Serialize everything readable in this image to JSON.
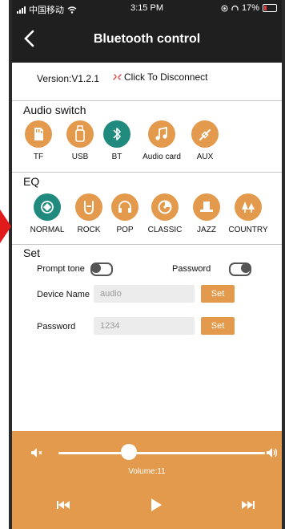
{
  "status_bar": {
    "carrier": "中国移动",
    "time": "3:15 PM",
    "battery": "17%"
  },
  "nav": {
    "title": "Bluetooth control"
  },
  "device": {
    "version": "Version:V1.2.1",
    "disconnect": "Click To Disconnect"
  },
  "audio_switch": {
    "title": "Audio switch",
    "selected": "BT",
    "items": [
      {
        "label": "TF",
        "icon": "sd-card-icon"
      },
      {
        "label": "USB",
        "icon": "usb-drive-icon"
      },
      {
        "label": "BT",
        "icon": "bluetooth-icon"
      },
      {
        "label": "Audio card",
        "icon": "music-note-icon"
      },
      {
        "label": "AUX",
        "icon": "aux-cable-icon"
      }
    ]
  },
  "eq": {
    "title": "EQ",
    "selected": "NORMAL",
    "items": [
      {
        "label": "NORMAL",
        "icon": "target-icon"
      },
      {
        "label": "ROCK",
        "icon": "rock-hand-icon"
      },
      {
        "label": "POP",
        "icon": "headphones-icon"
      },
      {
        "label": "CLASSIC",
        "icon": "disc-icon"
      },
      {
        "label": "JAZZ",
        "icon": "hat-icon"
      },
      {
        "label": "COUNTRY",
        "icon": "trees-icon"
      }
    ]
  },
  "settings": {
    "title": "Set",
    "prompt_tone_label": "Prompt tone",
    "prompt_tone_on": false,
    "password_label": "Password",
    "password_on": false,
    "device_name_label": "Device Name",
    "device_name_value": "audio",
    "password_field_label": "Password",
    "password_value": "1234",
    "set_button": "Set"
  },
  "player": {
    "volume_text": "Volume:11",
    "volume_fraction": 0.34
  },
  "colors": {
    "accent": "#e39a4c",
    "selected": "#1f8a7d",
    "header": "#1f1f1f"
  }
}
